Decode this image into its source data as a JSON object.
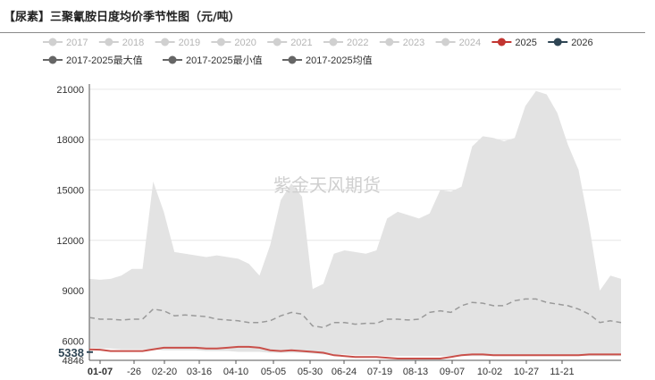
{
  "title": "【尿素】三聚氰胺日度均价季节性图（元/吨）",
  "watermark": "紫金天风期货",
  "chart_data": {
    "type": "area",
    "title": "【尿素】三聚氰胺日度均价季节性图（元/吨）",
    "xlabel": "",
    "ylabel": "",
    "x_ticks": [
      "01-07",
      "-26",
      "02-20",
      "03-16",
      "04-10",
      "05-05",
      "05-30",
      "06-24",
      "07-19",
      "08-13",
      "09-07",
      "10-02",
      "10-27",
      "11-21"
    ],
    "y_ticks": [
      4846,
      6000,
      9000,
      12000,
      15000,
      18000,
      21000
    ],
    "ylim": [
      4846,
      21100
    ],
    "grid": true,
    "legend_position": "top",
    "current_value_label": "5338",
    "legend": [
      {
        "name": "2017",
        "color": "#d0d0d0",
        "muted": true
      },
      {
        "name": "2018",
        "color": "#d0d0d0",
        "muted": true
      },
      {
        "name": "2019",
        "color": "#d0d0d0",
        "muted": true
      },
      {
        "name": "2020",
        "color": "#d0d0d0",
        "muted": true
      },
      {
        "name": "2021",
        "color": "#d0d0d0",
        "muted": true
      },
      {
        "name": "2022",
        "color": "#d0d0d0",
        "muted": true
      },
      {
        "name": "2023",
        "color": "#d0d0d0",
        "muted": true
      },
      {
        "name": "2024",
        "color": "#d0d0d0",
        "muted": true
      },
      {
        "name": "2025",
        "color": "#c23531",
        "muted": false
      },
      {
        "name": "2026",
        "color": "#2f4554",
        "muted": false
      },
      {
        "name": "2017-2025最大值",
        "color": "#666666",
        "muted": false
      },
      {
        "name": "2017-2025最小值",
        "color": "#666666",
        "muted": false
      },
      {
        "name": "2017-2025均值",
        "color": "#666666",
        "muted": false
      }
    ],
    "x": [
      0,
      1,
      2,
      3,
      4,
      5,
      6,
      7,
      8,
      9,
      10,
      11,
      12,
      13,
      14,
      15,
      16,
      17,
      18,
      19,
      20,
      21,
      22,
      23,
      24,
      25,
      26,
      27,
      28,
      29,
      30,
      31,
      32,
      33,
      34,
      35,
      36,
      37,
      38,
      39,
      40,
      41,
      42,
      43,
      44,
      45,
      46,
      47,
      48,
      49,
      50
    ],
    "series": [
      {
        "name": "2017-2025最大值",
        "values": [
          9700,
          9650,
          9700,
          9900,
          10300,
          10300,
          15500,
          13700,
          11300,
          11200,
          11100,
          11000,
          11100,
          11000,
          10900,
          10600,
          9900,
          11700,
          14400,
          15400,
          14600,
          9100,
          9400,
          11200,
          11400,
          11300,
          11200,
          11400,
          13300,
          13700,
          13500,
          13300,
          13600,
          15000,
          14900,
          15200,
          17600,
          18200,
          18100,
          17900,
          18100,
          20000,
          20900,
          20700,
          19600,
          17700,
          16200,
          12900,
          9000,
          9900,
          9700
        ]
      },
      {
        "name": "2017-2025最小值",
        "values": [
          5600,
          5550,
          5550,
          5500,
          5500,
          5500,
          5500,
          5450,
          5450,
          5450,
          5450,
          5400,
          5400,
          5400,
          5350,
          5350,
          5350,
          5300,
          5300,
          5300,
          5300,
          5250,
          5200,
          5200,
          5200,
          5150,
          5150,
          5150,
          5100,
          5100,
          5100,
          5100,
          5100,
          5100,
          5100,
          5100,
          5100,
          5100,
          5100,
          5100,
          5100,
          5100,
          5100,
          5100,
          5100,
          5100,
          5100,
          5100,
          5100,
          5100,
          5100
        ]
      },
      {
        "name": "2017-2025均值",
        "values": [
          7400,
          7300,
          7300,
          7250,
          7300,
          7300,
          7900,
          7800,
          7500,
          7550,
          7500,
          7450,
          7300,
          7250,
          7200,
          7100,
          7100,
          7200,
          7500,
          7700,
          7600,
          6900,
          6800,
          7100,
          7100,
          7000,
          7050,
          7050,
          7300,
          7300,
          7250,
          7300,
          7700,
          7800,
          7700,
          8100,
          8300,
          8250,
          8100,
          8100,
          8400,
          8500,
          8500,
          8300,
          8200,
          8100,
          7900,
          7600,
          7100,
          7200,
          7100
        ]
      },
      {
        "name": "2025",
        "values": [
          5500,
          5480,
          5400,
          5400,
          5400,
          5400,
          5500,
          5600,
          5600,
          5600,
          5600,
          5550,
          5550,
          5600,
          5650,
          5650,
          5600,
          5450,
          5400,
          5450,
          5400,
          5350,
          5300,
          5150,
          5100,
          5050,
          5050,
          5050,
          5000,
          4950,
          4950,
          4950,
          4950,
          4950,
          5050,
          5150,
          5200,
          5200,
          5150,
          5150,
          5150,
          5150,
          5150,
          5150,
          5150,
          5150,
          5150,
          5200,
          5200,
          5200,
          5200
        ]
      },
      {
        "name": "2026",
        "values": [
          5338
        ]
      }
    ]
  }
}
